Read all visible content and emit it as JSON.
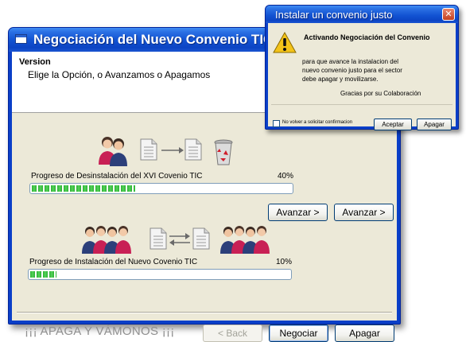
{
  "main_window": {
    "title": "Negociación del Nuevo Convenio TIC",
    "header": {
      "heading": "Version",
      "subtitle": "Elige la Opción, o Avanzamos o Apagamos"
    },
    "uninstall": {
      "label": "Progreso de Desinstalación del XVI Covenio TIC",
      "percent_text": "40%",
      "progress": 0.4
    },
    "install": {
      "label": "Progreso de Instalación del Nuevo Covenio TIC",
      "percent_text": "10%",
      "progress": 0.1
    },
    "buttons": {
      "avanzar_1": "Avanzar >",
      "avanzar_2": "Avanzar >",
      "back": "< Back",
      "negociar": "Negociar",
      "apagar": "Apagar"
    },
    "footer_text": "¡¡¡ APAGA Y VÁMONOS ¡¡¡",
    "icons": [
      "people-icon",
      "document-icon",
      "arrow-right-icon",
      "recycle-bin-icon",
      "arrows-exchange-icon"
    ]
  },
  "dialog": {
    "title": "Instalar un convenio justo",
    "heading": "Activando Negociación del Convenio",
    "message_lines": [
      "para que avance la instalacion del",
      "nuevo convenio justo para el sector",
      "debe apagar y movilizarse."
    ],
    "thanks": "Gracias por su Colaboración",
    "checkbox_label": "No volver a solicitar confirmacion",
    "accept_label": "Aceptar",
    "shutdown_label": "Apagar",
    "icon": "warning-icon"
  },
  "colors": {
    "titlebar_blue": "#0c44c4",
    "progress_green": "#2bb031",
    "window_face": "#ece9d8"
  }
}
